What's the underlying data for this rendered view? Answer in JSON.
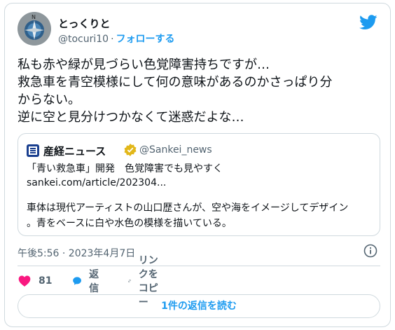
{
  "author": {
    "name": "とっくりと",
    "handle": "@tocuri10",
    "separator": "·",
    "follow_label": "フォローする"
  },
  "tweet": {
    "lines": [
      "私も赤や緑が見づらい色覚障害持ちですが…",
      "救急車を青空模様にして何の意味があるのかさっぱり分",
      "からない。",
      "逆に空と見分けつかなくて迷惑だよな…"
    ]
  },
  "quote": {
    "name": "産経ニュース",
    "handle": "@Sankei_news",
    "title": "「青い救急車」開発　色覚障害でも見やすく",
    "link": "sankei.com/article/202304...",
    "body_lines": [
      "車体は現代アーティストの山口歴さんが、空や海をイメージしてデザイン",
      "。青をベースに白や水色の模様を描いている。"
    ]
  },
  "timestamp": "午後5:56 · 2023年4月7日",
  "actions": {
    "like_count": "81",
    "reply_label": "返信",
    "copy_link_label": "リンクをコピー"
  },
  "read_replies_label": "1件の返信を読む",
  "colors": {
    "twitter_blue": "#1d9bf0",
    "like_pink": "#f91880",
    "text": "#0f1419",
    "muted": "#536471",
    "border": "#cfd9de"
  },
  "icons": [
    "twitter-bird-icon",
    "verified-gold-icon",
    "info-icon",
    "heart-icon",
    "reply-bubble-icon",
    "link-icon"
  ]
}
